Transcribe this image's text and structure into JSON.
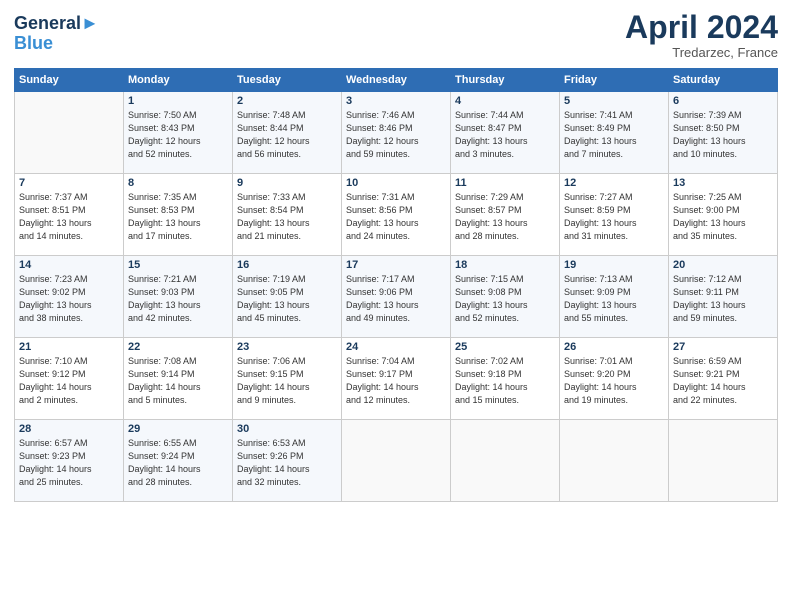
{
  "header": {
    "logo_line1": "General",
    "logo_line2": "Blue",
    "month": "April 2024",
    "location": "Tredarzec, France"
  },
  "weekdays": [
    "Sunday",
    "Monday",
    "Tuesday",
    "Wednesday",
    "Thursday",
    "Friday",
    "Saturday"
  ],
  "weeks": [
    [
      {
        "day": "",
        "info": ""
      },
      {
        "day": "1",
        "info": "Sunrise: 7:50 AM\nSunset: 8:43 PM\nDaylight: 12 hours\nand 52 minutes."
      },
      {
        "day": "2",
        "info": "Sunrise: 7:48 AM\nSunset: 8:44 PM\nDaylight: 12 hours\nand 56 minutes."
      },
      {
        "day": "3",
        "info": "Sunrise: 7:46 AM\nSunset: 8:46 PM\nDaylight: 12 hours\nand 59 minutes."
      },
      {
        "day": "4",
        "info": "Sunrise: 7:44 AM\nSunset: 8:47 PM\nDaylight: 13 hours\nand 3 minutes."
      },
      {
        "day": "5",
        "info": "Sunrise: 7:41 AM\nSunset: 8:49 PM\nDaylight: 13 hours\nand 7 minutes."
      },
      {
        "day": "6",
        "info": "Sunrise: 7:39 AM\nSunset: 8:50 PM\nDaylight: 13 hours\nand 10 minutes."
      }
    ],
    [
      {
        "day": "7",
        "info": "Sunrise: 7:37 AM\nSunset: 8:51 PM\nDaylight: 13 hours\nand 14 minutes."
      },
      {
        "day": "8",
        "info": "Sunrise: 7:35 AM\nSunset: 8:53 PM\nDaylight: 13 hours\nand 17 minutes."
      },
      {
        "day": "9",
        "info": "Sunrise: 7:33 AM\nSunset: 8:54 PM\nDaylight: 13 hours\nand 21 minutes."
      },
      {
        "day": "10",
        "info": "Sunrise: 7:31 AM\nSunset: 8:56 PM\nDaylight: 13 hours\nand 24 minutes."
      },
      {
        "day": "11",
        "info": "Sunrise: 7:29 AM\nSunset: 8:57 PM\nDaylight: 13 hours\nand 28 minutes."
      },
      {
        "day": "12",
        "info": "Sunrise: 7:27 AM\nSunset: 8:59 PM\nDaylight: 13 hours\nand 31 minutes."
      },
      {
        "day": "13",
        "info": "Sunrise: 7:25 AM\nSunset: 9:00 PM\nDaylight: 13 hours\nand 35 minutes."
      }
    ],
    [
      {
        "day": "14",
        "info": "Sunrise: 7:23 AM\nSunset: 9:02 PM\nDaylight: 13 hours\nand 38 minutes."
      },
      {
        "day": "15",
        "info": "Sunrise: 7:21 AM\nSunset: 9:03 PM\nDaylight: 13 hours\nand 42 minutes."
      },
      {
        "day": "16",
        "info": "Sunrise: 7:19 AM\nSunset: 9:05 PM\nDaylight: 13 hours\nand 45 minutes."
      },
      {
        "day": "17",
        "info": "Sunrise: 7:17 AM\nSunset: 9:06 PM\nDaylight: 13 hours\nand 49 minutes."
      },
      {
        "day": "18",
        "info": "Sunrise: 7:15 AM\nSunset: 9:08 PM\nDaylight: 13 hours\nand 52 minutes."
      },
      {
        "day": "19",
        "info": "Sunrise: 7:13 AM\nSunset: 9:09 PM\nDaylight: 13 hours\nand 55 minutes."
      },
      {
        "day": "20",
        "info": "Sunrise: 7:12 AM\nSunset: 9:11 PM\nDaylight: 13 hours\nand 59 minutes."
      }
    ],
    [
      {
        "day": "21",
        "info": "Sunrise: 7:10 AM\nSunset: 9:12 PM\nDaylight: 14 hours\nand 2 minutes."
      },
      {
        "day": "22",
        "info": "Sunrise: 7:08 AM\nSunset: 9:14 PM\nDaylight: 14 hours\nand 5 minutes."
      },
      {
        "day": "23",
        "info": "Sunrise: 7:06 AM\nSunset: 9:15 PM\nDaylight: 14 hours\nand 9 minutes."
      },
      {
        "day": "24",
        "info": "Sunrise: 7:04 AM\nSunset: 9:17 PM\nDaylight: 14 hours\nand 12 minutes."
      },
      {
        "day": "25",
        "info": "Sunrise: 7:02 AM\nSunset: 9:18 PM\nDaylight: 14 hours\nand 15 minutes."
      },
      {
        "day": "26",
        "info": "Sunrise: 7:01 AM\nSunset: 9:20 PM\nDaylight: 14 hours\nand 19 minutes."
      },
      {
        "day": "27",
        "info": "Sunrise: 6:59 AM\nSunset: 9:21 PM\nDaylight: 14 hours\nand 22 minutes."
      }
    ],
    [
      {
        "day": "28",
        "info": "Sunrise: 6:57 AM\nSunset: 9:23 PM\nDaylight: 14 hours\nand 25 minutes."
      },
      {
        "day": "29",
        "info": "Sunrise: 6:55 AM\nSunset: 9:24 PM\nDaylight: 14 hours\nand 28 minutes."
      },
      {
        "day": "30",
        "info": "Sunrise: 6:53 AM\nSunset: 9:26 PM\nDaylight: 14 hours\nand 32 minutes."
      },
      {
        "day": "",
        "info": ""
      },
      {
        "day": "",
        "info": ""
      },
      {
        "day": "",
        "info": ""
      },
      {
        "day": "",
        "info": ""
      }
    ]
  ]
}
